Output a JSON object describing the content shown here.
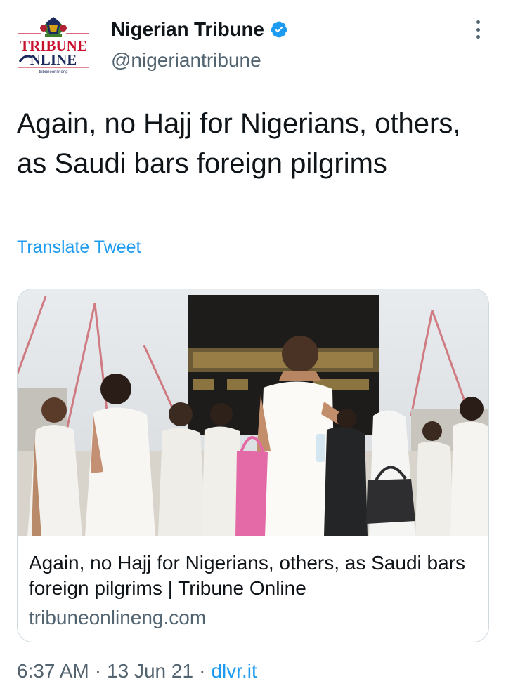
{
  "author": {
    "display_name": "Nigerian Tribune",
    "handle": "@nigeriantribune",
    "avatar_icon": "tribune-online-logo",
    "avatar_logo_text_top": "TRIBUNE",
    "avatar_logo_text_bottom": "NLINE",
    "avatar_logo_small": "tribuneonlineng",
    "verified_icon": "verified-badge-icon",
    "more_icon": "more-vertical-icon"
  },
  "tweet": {
    "text": "Again, no Hajj for Nigerians, others, as Saudi bars foreign pilgrims",
    "translate_label": "Translate Tweet"
  },
  "card": {
    "image_description_icon": "hajj-pilgrims-photo",
    "title": "Again, no Hajj for Nigerians, others, as Saudi bars foreign pilgrims | Tribune Online",
    "domain": "tribuneonlineng.com"
  },
  "meta": {
    "time": "6:37 AM",
    "date": "13 Jun 21",
    "separator": "·",
    "source": "dlvr.it"
  },
  "colors": {
    "link": "#1d9bf0",
    "secondary_text": "#536471",
    "primary_text": "#0f1419",
    "border": "#cfd9de",
    "logo_red": "#c8102e",
    "logo_navy": "#1b2a5e"
  }
}
